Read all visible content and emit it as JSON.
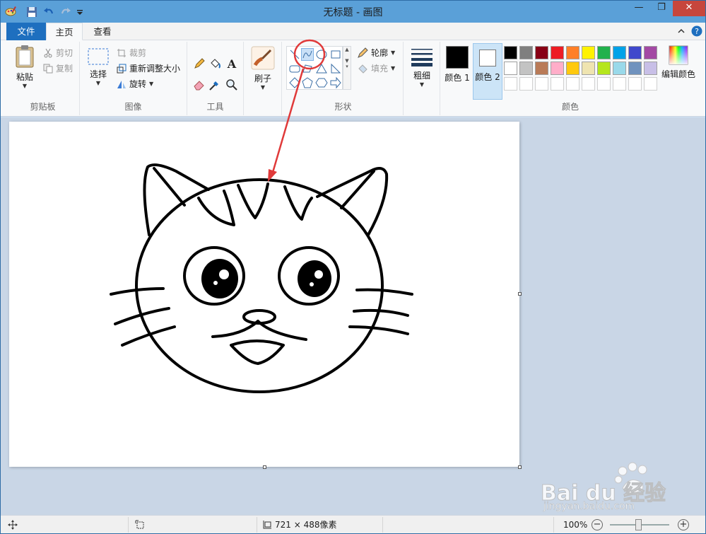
{
  "window": {
    "title": "无标题 - 画图"
  },
  "tabs": {
    "file": "文件",
    "home": "主页",
    "view": "查看"
  },
  "clipboard": {
    "paste": "粘贴",
    "cut": "剪切",
    "copy": "复制",
    "label": "剪贴板"
  },
  "image": {
    "select": "选择",
    "crop": "裁剪",
    "resize": "重新调整大小",
    "rotate": "旋转",
    "label": "图像"
  },
  "tools": {
    "label": "工具"
  },
  "brush": {
    "label": "刷子"
  },
  "shapes": {
    "outline": "轮廓",
    "fill": "填充",
    "label": "形状"
  },
  "size": {
    "label": "粗细"
  },
  "colors": {
    "color1_label": "颜色 1",
    "color2_label": "颜色 2",
    "edit_label": "编辑颜色",
    "group_label": "颜色",
    "color1": "#000000",
    "color2": "#ffffff",
    "palette_row1": [
      "#000000",
      "#7f7f7f",
      "#880015",
      "#ed1c24",
      "#ff7f27",
      "#fff200",
      "#22b14c",
      "#00a2e8",
      "#3f48cc",
      "#a349a4"
    ],
    "palette_row2": [
      "#ffffff",
      "#c3c3c3",
      "#b97a57",
      "#ffaec9",
      "#ffc90e",
      "#efe4b0",
      "#b5e61d",
      "#99d9ea",
      "#7092be",
      "#c8bfe7"
    ]
  },
  "status": {
    "dimensions": "721 × 488像素",
    "zoom": "100%"
  },
  "watermark": {
    "brand": "Bai du 经验",
    "url": "jingyan.baidu.com"
  }
}
